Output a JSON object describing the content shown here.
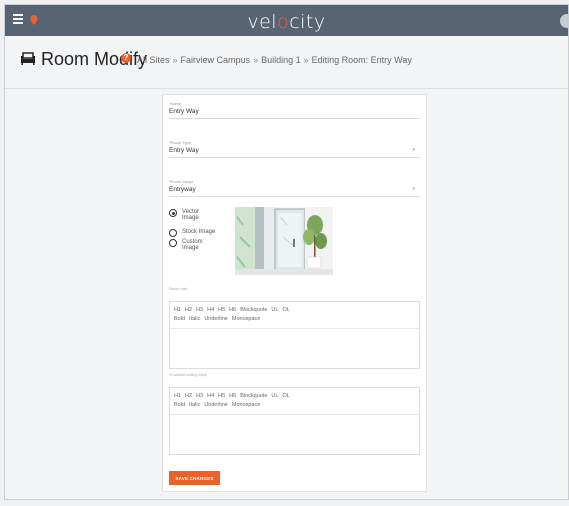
{
  "app": {
    "brand_prefix": "vel",
    "brand_accent": "o",
    "brand_suffix": "city"
  },
  "header": {
    "title": "Room Modify",
    "help_glyph": "?",
    "breadcrumbs": [
      "All Sites",
      "Fairview Campus",
      "Building 1",
      "Editing Room: Entry Way"
    ],
    "separator": "»"
  },
  "form": {
    "name": {
      "label": "*Name",
      "value": "Entry Way"
    },
    "room_type": {
      "label": "*Room Type",
      "value": "Entry Way"
    },
    "room_image": {
      "label": "*Room Image",
      "value": "Entryway"
    },
    "image_options": [
      {
        "label": "Vector Image",
        "line1": "Vector",
        "line2": "Image",
        "selected": true
      },
      {
        "label": "Stock Image",
        "line1": "Stock Image",
        "line2": "",
        "selected": false
      },
      {
        "label": "Custom Image",
        "line1": "Custom",
        "line2": "Image",
        "selected": false
      }
    ],
    "room_info_label": "Room Info",
    "troubleshooting_label": "Troubleshooting Help",
    "toolbar_row1": [
      "H1",
      "H2",
      "H3",
      "H4",
      "H5",
      "H6",
      "Blockquote",
      "UL",
      "OL"
    ],
    "toolbar_row2": [
      "Bold",
      "Italic",
      "Underline",
      "Monospace"
    ],
    "save_label": "SAVE CHANGES"
  },
  "colors": {
    "accent": "#e8622c",
    "topbar": "#566473"
  }
}
